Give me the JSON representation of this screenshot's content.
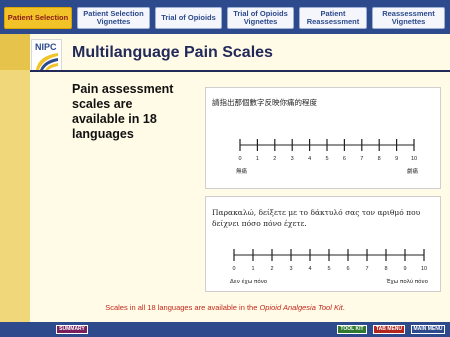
{
  "nav": {
    "tabs": [
      {
        "label": "Patient Selection",
        "active": true
      },
      {
        "label": "Patient Selection Vignettes",
        "active": false
      },
      {
        "label": "Trial of Opioids",
        "active": false
      },
      {
        "label": "Trial of Opioids Vignettes",
        "active": false
      },
      {
        "label": "Patient Reassessment",
        "active": false
      },
      {
        "label": "Reassessment Vignettes",
        "active": false
      }
    ]
  },
  "logo": {
    "text": "NIPC"
  },
  "page": {
    "title": "Multilanguage Pain Scales",
    "lede": "Pain assessment scales are available in 18 languages",
    "caption_prefix": "Scales in all 18 languages are available in the ",
    "caption_italic": "Opioid Analgesia Tool Kit",
    "caption_suffix": "."
  },
  "scales": {
    "chinese": {
      "heading": "請指出那個數字反映你痛的程度",
      "ticks": [
        "0",
        "1",
        "2",
        "3",
        "4",
        "5",
        "6",
        "7",
        "8",
        "9",
        "10"
      ],
      "left_anchor": "無痛",
      "right_anchor": "劇痛"
    },
    "greek": {
      "heading": "Παρακαλώ, δείξετε με το δάκτυλό σας τον αριθμό που δείχνει πόσο πόνο έχετε.",
      "ticks": [
        "0",
        "1",
        "2",
        "3",
        "4",
        "5",
        "6",
        "7",
        "8",
        "9",
        "10"
      ],
      "left_anchor": "Δεν έχω πόνο",
      "right_anchor": "Έχω πολύ πόνο"
    }
  },
  "bottom_nav": {
    "summary": "SUMMARY",
    "tool_kit": "TOOL KIT",
    "tab_menu": "TAB MENU",
    "main_menu": "MAIN MENU"
  },
  "colors": {
    "nav": "#2d4a8c",
    "active_tab": "#f2c229",
    "title": "#222a5a",
    "caption": "#c4261b",
    "summary_btn": "#7a1f5c",
    "tool_kit_btn": "#2f7a2f",
    "tab_menu_btn": "#b3261e",
    "main_menu_btn": "#2d4a8c"
  }
}
